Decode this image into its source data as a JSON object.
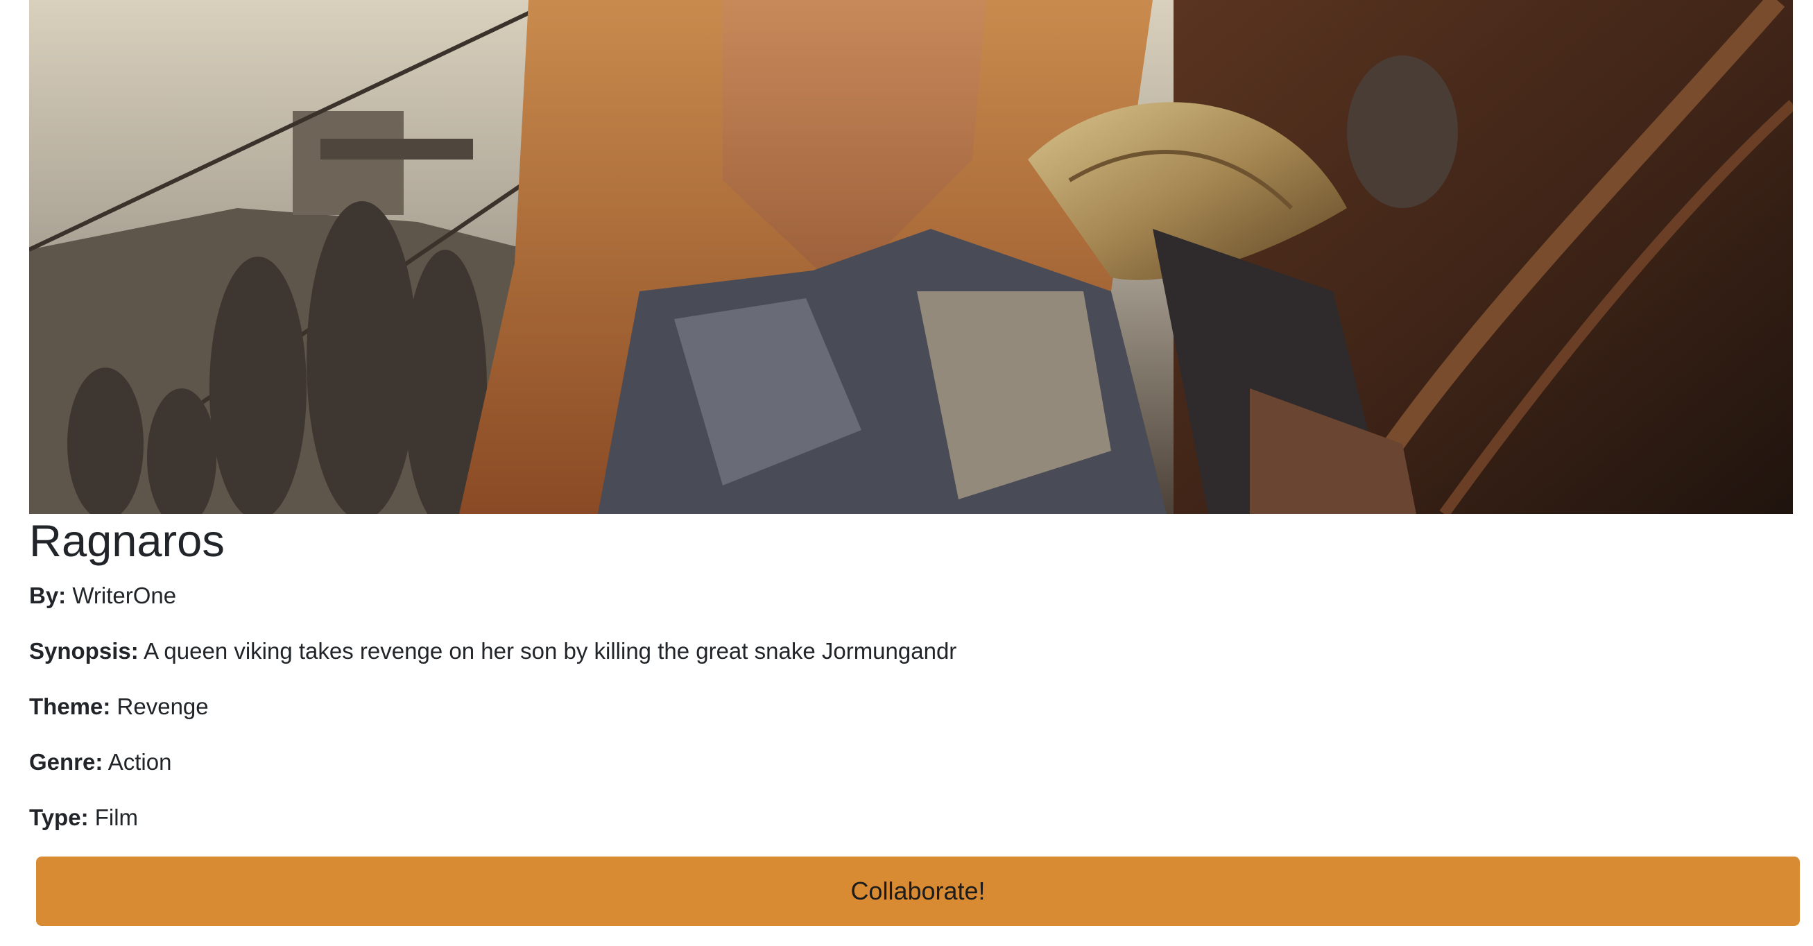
{
  "story": {
    "title": "Ragnaros",
    "by_label": "By:",
    "author": "WriterOne",
    "synopsis_label": "Synopsis:",
    "synopsis": "A queen viking takes revenge on her son by killing the great snake Jormungandr",
    "theme_label": "Theme:",
    "theme": "Revenge",
    "genre_label": "Genre:",
    "genre": "Action",
    "type_label": "Type:",
    "type": "Film"
  },
  "actions": {
    "collaborate_label": "Collaborate!"
  },
  "colors": {
    "button_bg": "#d98b33",
    "text": "#212529"
  },
  "icons": {
    "cover": "viking-warrior-cover-image"
  }
}
